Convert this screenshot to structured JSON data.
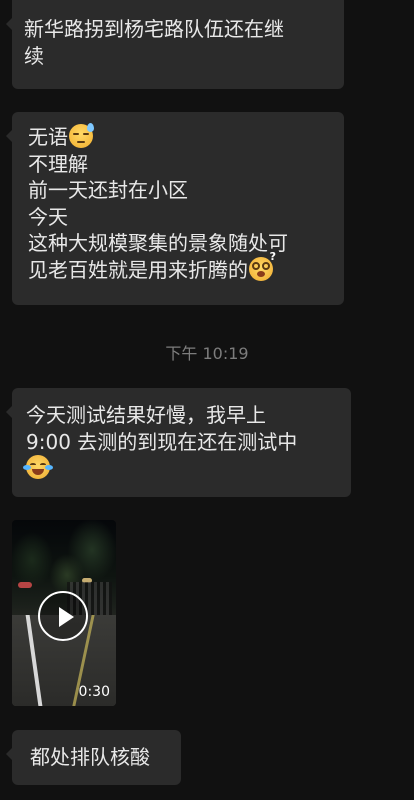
{
  "messages": [
    {
      "lines": [
        "新华路拐到杨宅路队伍还在继",
        "续"
      ]
    },
    {
      "lines": [
        "无语",
        "不理解",
        "前一天还封在小区",
        "今天",
        "这种大规模聚集的景象随处可",
        "见老百姓就是用来折腾的"
      ],
      "emoji_after_line_1": "sweat-face-icon",
      "emoji_after_line_6": "dizzy-face-icon"
    },
    {
      "time": "下午 10:19"
    },
    {
      "lines": [
        "今天测试结果好慢，我早上",
        "9:00 去测的到现在还在测试中"
      ],
      "emoji_line_3": "crying-face-icon"
    },
    {
      "video": {
        "duration": "0:30"
      }
    },
    {
      "lines": [
        "都处排队核酸"
      ]
    }
  ],
  "colors": {
    "background": "#111111",
    "bubble": "#2b2b2b",
    "text": "#e8e8e8",
    "timestamp": "#7d7d7d"
  }
}
